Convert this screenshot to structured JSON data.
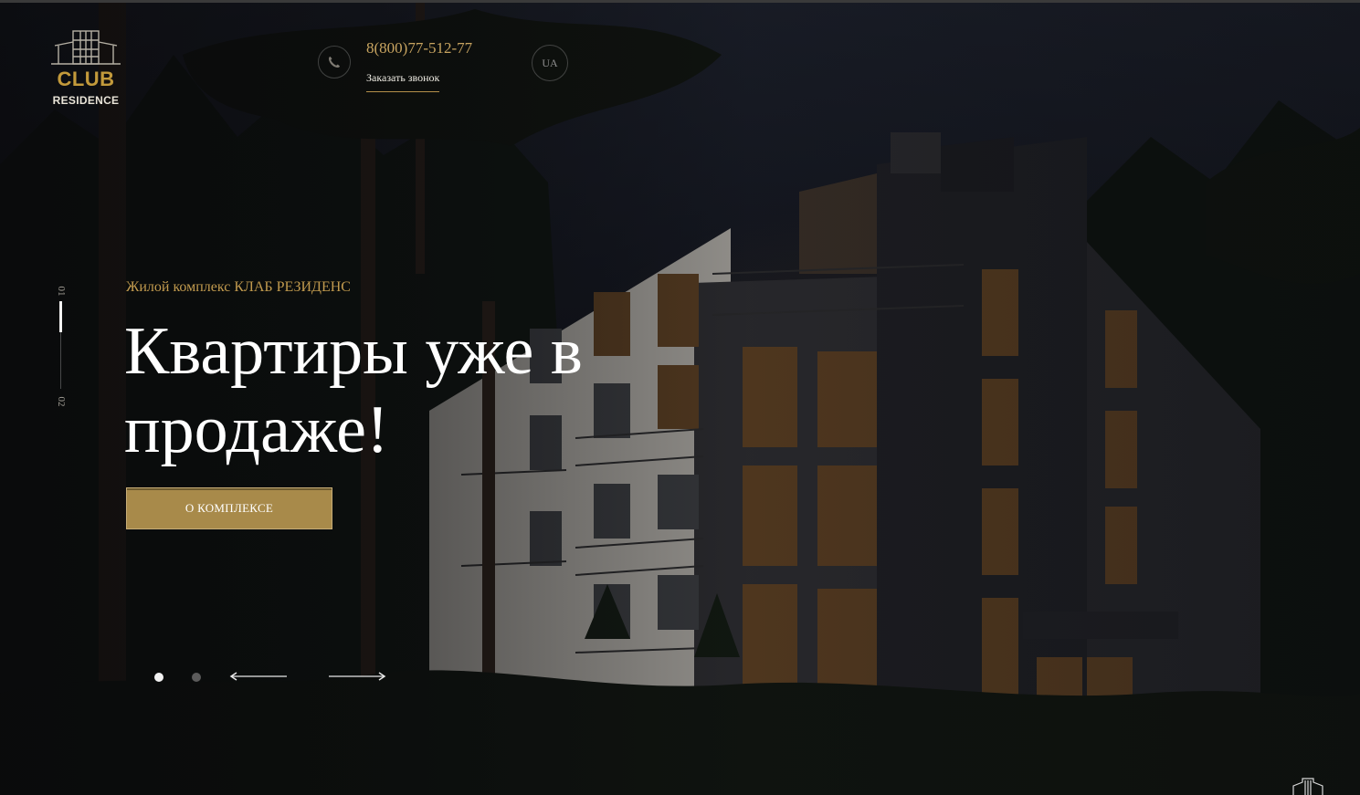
{
  "brand": {
    "logo_word1": "CLUB",
    "logo_word2": "RESIDENCE",
    "logo_color": "#c39a3b"
  },
  "header": {
    "phone_icon": "phone-icon",
    "phone_number": "8(800)77-512-77",
    "callback_label": "Заказать звонок",
    "language_label": "UA"
  },
  "slider": {
    "current_index_label": "01",
    "next_index_label": "02",
    "progress_fraction": 0.35,
    "subtitle": "Жилой комплекс КЛАБ РЕЗИДЕНС",
    "title": "Квартиры уже в продаже!",
    "cta_label": "О КОМПЛЕКСЕ",
    "dots": 2,
    "active_dot": 1,
    "prev_icon": "arrow-left-icon",
    "next_icon": "arrow-right-icon"
  },
  "colors": {
    "accent": "#a88a4a",
    "accent_text": "#c19a4e",
    "background": "#0d0e12"
  }
}
